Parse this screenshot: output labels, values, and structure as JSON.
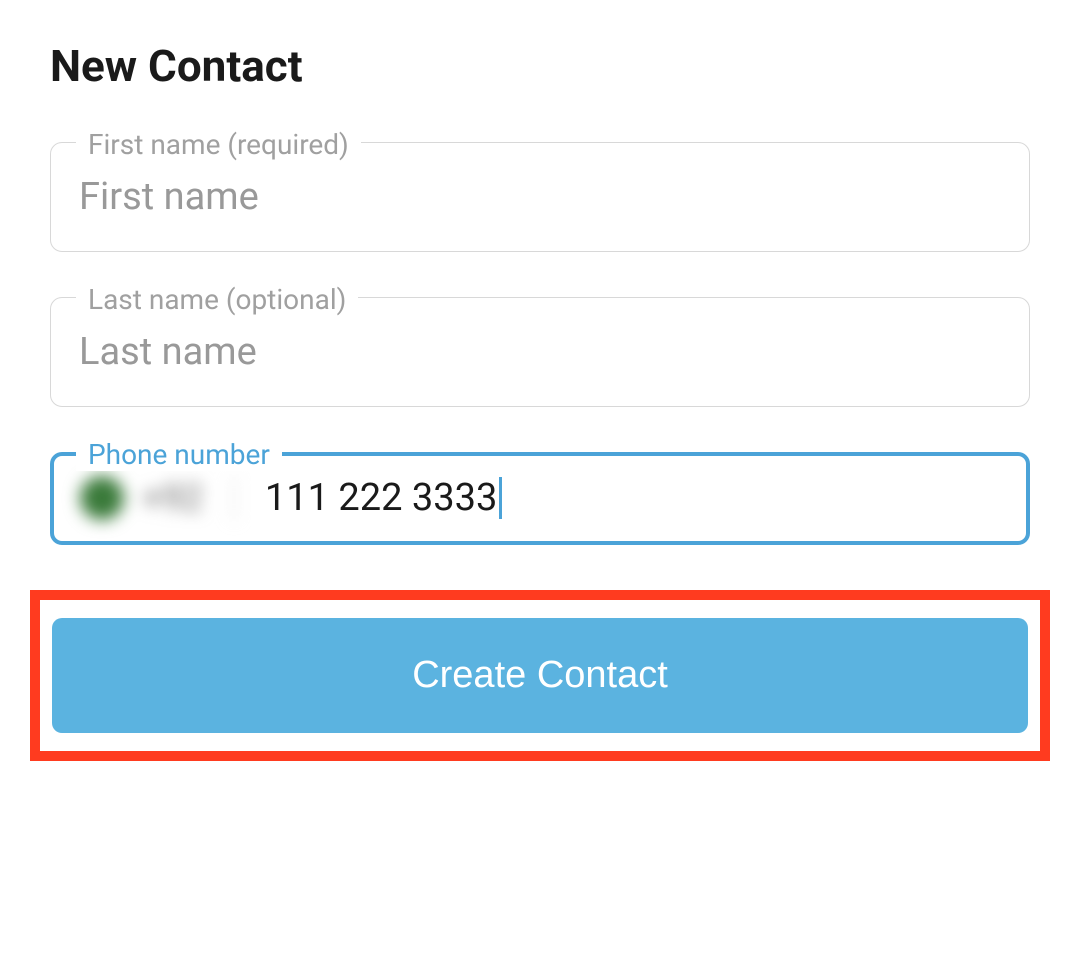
{
  "title": "New Contact",
  "fields": {
    "firstName": {
      "label": "First name (required)",
      "placeholder": "First name"
    },
    "lastName": {
      "label": "Last name (optional)",
      "placeholder": "Last name"
    },
    "phone": {
      "label": "Phone number",
      "countryCode": "+92",
      "value": "111 222 3333"
    }
  },
  "button": {
    "create": "Create Contact"
  }
}
